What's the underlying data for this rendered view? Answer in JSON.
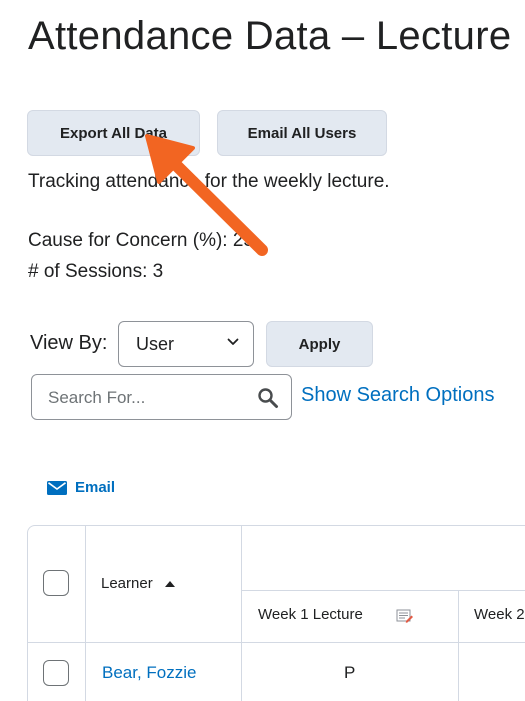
{
  "page": {
    "title": "Attendance Data – Lecture"
  },
  "toolbar": {
    "export_label": "Export All Data",
    "email_all_label": "Email All Users"
  },
  "info": {
    "description": "Tracking attendance for the weekly lecture.",
    "concern": "Cause for Concern (%): 25",
    "sessions": "# of Sessions: 3"
  },
  "view_by": {
    "label": "View By:",
    "selected": "User",
    "apply_label": "Apply"
  },
  "search": {
    "placeholder": "Search For...",
    "value": "",
    "options_link": "Show Search Options"
  },
  "actions": {
    "email_label": "Email"
  },
  "table": {
    "columns": {
      "learner": "Learner",
      "weeks": [
        "Week 1 Lecture",
        "Week 2"
      ]
    },
    "rows": [
      {
        "learner": "Bear, Fozzie",
        "week1": "P"
      }
    ]
  },
  "colors": {
    "accent_link": "#006fbf",
    "button_bg": "#e3e9f1",
    "annotation_arrow": "#f26522"
  },
  "icons": {
    "sort": "sort-ascending-icon",
    "search": "search-icon",
    "email": "envelope-icon",
    "dropdown": "chevron-down-icon",
    "grade_edit": "edit-grade-icon",
    "annotation": "arrow-pointer-icon"
  }
}
